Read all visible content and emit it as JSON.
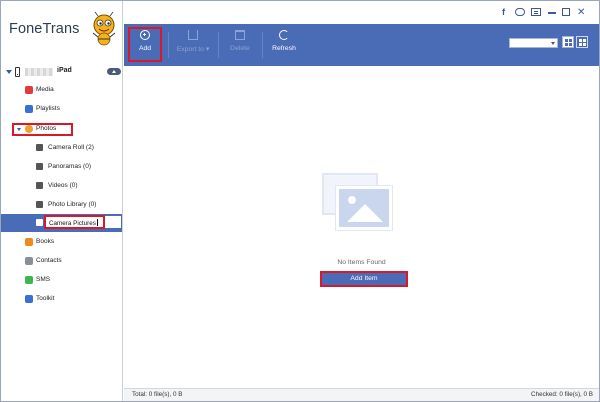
{
  "app": {
    "title": "FoneTrans"
  },
  "device": {
    "name": "iPad"
  },
  "sidebar": {
    "items": [
      {
        "label": "Media",
        "color": "#e33b3b"
      },
      {
        "label": "Playlists",
        "color": "#3b6fd8"
      },
      {
        "label": "Photos",
        "color": "#f0a030"
      },
      {
        "label": "Camera Roll (2)"
      },
      {
        "label": "Panoramas (0)"
      },
      {
        "label": "Videos (0)"
      },
      {
        "label": "Photo Library (0)"
      },
      {
        "label": "Camera Pictures"
      },
      {
        "label": "Books",
        "color": "#f08a1e"
      },
      {
        "label": "Contacts",
        "color": "#8a8f96"
      },
      {
        "label": "SMS",
        "color": "#3cb84a"
      },
      {
        "label": "Toolkit",
        "color": "#3b6fd8"
      }
    ]
  },
  "toolbar": {
    "add_label": "Add",
    "export_label": "Export to",
    "delete_label": "Delete",
    "refresh_label": "Refresh"
  },
  "content": {
    "empty_message": "No Items Found",
    "add_item_label": "Add Item"
  },
  "status": {
    "total": "Total: 0 file(s), 0 B",
    "checked": "Checked: 0 file(s), 0 B"
  },
  "colors": {
    "accent": "#4a6bb5",
    "highlight_box": "#d9182a"
  }
}
